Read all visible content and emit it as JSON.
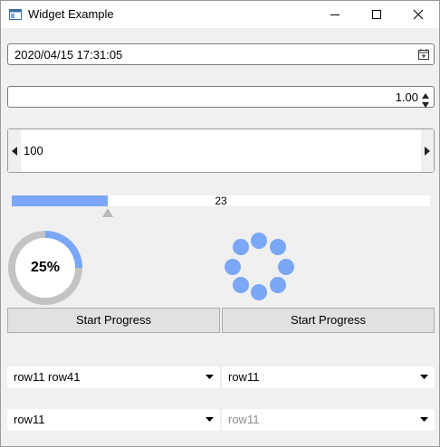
{
  "window": {
    "title": "Widget Example"
  },
  "datetime_edit": {
    "value": "2020/04/15 17:31:05"
  },
  "double_spinbox": {
    "value": "1.00"
  },
  "slider": {
    "value": "100"
  },
  "progress_bar": {
    "value": "23",
    "fraction": 0.23
  },
  "ring_progress": {
    "label": "25%",
    "fraction": 0.25
  },
  "buttons": {
    "left": "Start Progress",
    "right": "Start Progress"
  },
  "combos": [
    {
      "text": "row11 row41",
      "enabled": true
    },
    {
      "text": "row11",
      "enabled": true
    },
    {
      "text": "row11",
      "enabled": true
    },
    {
      "text": "row11",
      "enabled": false
    }
  ],
  "colors": {
    "accent": "#7aa7f7",
    "ring_track": "#c3c3c3"
  },
  "icons": {
    "app": "window-icon",
    "minimize": "minimize-icon",
    "maximize": "maximize-icon",
    "close": "close-icon",
    "calendar": "calendar-icon"
  }
}
